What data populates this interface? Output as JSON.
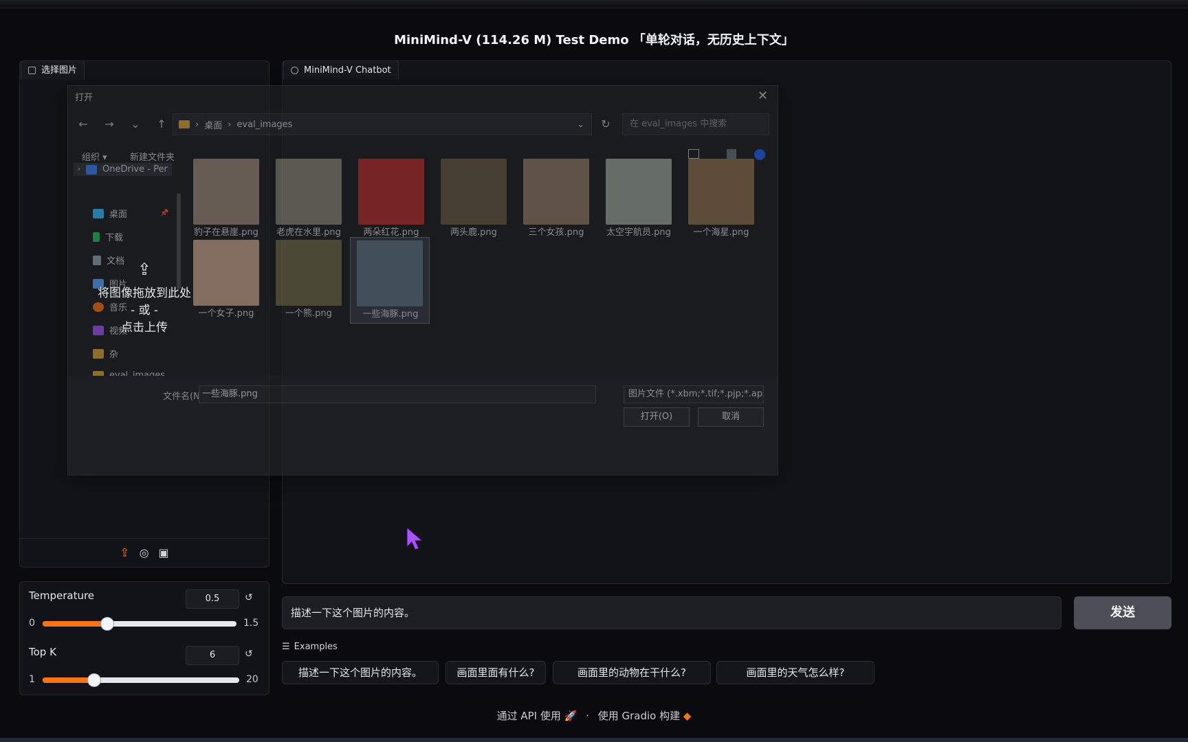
{
  "app_title": "MiniMind-V (114.26 M) Test Demo 「单轮对话，无历史上下文」",
  "image_panel": {
    "tab_label": "选择图片",
    "upload_text": "将图像拖放到此处",
    "upload_or": "- 或 -",
    "upload_click": "点击上传"
  },
  "chat_panel": {
    "tab_label": "MiniMind-V Chatbot"
  },
  "file_dialog": {
    "title": "打开",
    "breadcrumb": [
      "桌面",
      "eval_images"
    ],
    "search_placeholder": "在 eval_images 中搜索",
    "toolbar": {
      "organize": "组织 ▾",
      "new_folder": "新建文件夹"
    },
    "sidebar": [
      {
        "label": "OneDrive - Per",
        "icon": "cloud-icon",
        "color": "#3b82f6"
      },
      {
        "label": "桌面",
        "icon": "desktop-icon",
        "color": "#38bdf8"
      },
      {
        "label": "下载",
        "icon": "download-icon",
        "color": "#22c55e"
      },
      {
        "label": "文档",
        "icon": "document-icon",
        "color": "#94a3b8"
      },
      {
        "label": "图片",
        "icon": "picture-icon",
        "color": "#60a5fa"
      },
      {
        "label": "音乐",
        "icon": "music-icon",
        "color": "#f97316"
      },
      {
        "label": "视频",
        "icon": "video-icon",
        "color": "#a855f7"
      },
      {
        "label": "杂",
        "icon": "folder-icon",
        "color": "#d9a53d"
      },
      {
        "label": "eval_images",
        "icon": "folder-icon",
        "color": "#d9a53d"
      }
    ],
    "files": [
      {
        "name": "豹子在悬崖.png",
        "color": "#9a8a78"
      },
      {
        "name": "老虎在水里.png",
        "color": "#8a8576"
      },
      {
        "name": "两朵红花.png",
        "color": "#b5302c"
      },
      {
        "name": "两头鹿.png",
        "color": "#6b5a44"
      },
      {
        "name": "三个女孩.png",
        "color": "#8f7a63"
      },
      {
        "name": "太空宇航员.png",
        "color": "#9aa59a"
      },
      {
        "name": "一个海星.png",
        "color": "#8b6f4e"
      },
      {
        "name": "一个女子.png",
        "color": "#c9a48a"
      },
      {
        "name": "一个熊.png",
        "color": "#6f6a48"
      },
      {
        "name": "一些海豚.png",
        "color": "#5f7583"
      }
    ],
    "filename_label": "文件名(N):",
    "filename_value": "一些海豚.png",
    "filetype_value": "图片文件 (*.xbm;*.tif;*.pjp;*.ap",
    "open_button": "打开(O)",
    "cancel_button": "取消"
  },
  "controls": {
    "temperature": {
      "label": "Temperature",
      "value": "0.5",
      "min": "0",
      "max": "1.5",
      "fraction": 0.333
    },
    "top_k": {
      "label": "Top K",
      "value": "6",
      "min": "1",
      "max": "20",
      "fraction": 0.263
    }
  },
  "message_input": "描述一下这个图片的内容。",
  "send_button": "发送",
  "examples_label": "Examples",
  "examples": [
    "描述一下这个图片的内容。",
    "画面里面有什么?",
    "画面里的动物在干什么?",
    "画面里的天气怎么样?"
  ],
  "footer": {
    "api": "通过 API 使用",
    "sep": "·",
    "built": "使用 Gradio 构建"
  },
  "colors": {
    "accent": "#f97316",
    "cursor": "#a855f7"
  }
}
